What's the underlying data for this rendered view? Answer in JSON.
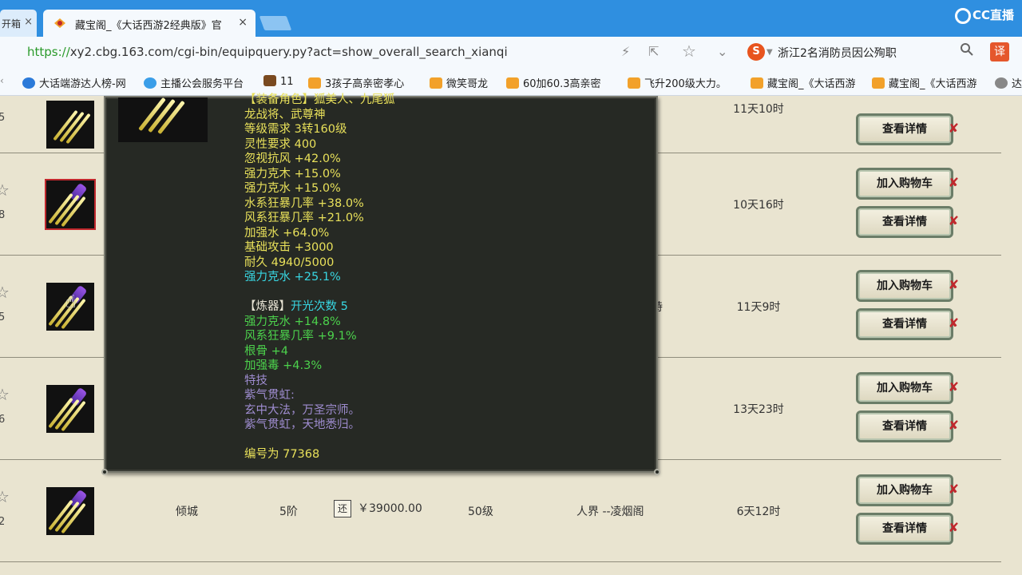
{
  "browser": {
    "small_tab_label": "开箱",
    "active_tab_title": "藏宝阁_《大话西游2经典版》官",
    "url_proto": "https://",
    "url_rest": "xy2.cbg.163.com/cgi-bin/equipquery.py?act=show_overall_search_xianqi",
    "search_text": "浙江2名消防员因公殉职",
    "search_engine_letter": "S",
    "translate_label": "译",
    "cc_logo": "CC直播"
  },
  "bookmarks": [
    {
      "label": "大话端游达人榜-网",
      "color": "#2b7ad9"
    },
    {
      "label": "主播公会服务平台",
      "color": "#3a9ee8"
    },
    {
      "label": "11",
      "color": "#7a4a20"
    },
    {
      "label": "3孩子高亲密孝心",
      "color": "#f2a12a"
    },
    {
      "label": "微笑哥龙",
      "color": "#f2a12a"
    },
    {
      "label": "60加60.3高亲密",
      "color": "#f2a12a"
    },
    {
      "label": "飞升200级大力。",
      "color": "#f2a12a"
    },
    {
      "label": "藏宝阁_《大话西游",
      "color": "#f2a12a"
    },
    {
      "label": "藏宝阁_《大话西游",
      "color": "#f2a12a"
    },
    {
      "label": "达",
      "color": "#888888"
    }
  ],
  "rows": [
    {
      "left_num": "5",
      "time": "11天10时",
      "buttons": [
        "查看详情"
      ]
    },
    {
      "left_num": "8",
      "time": "10天16时",
      "buttons": [
        "加入购物车",
        "查看详情"
      ]
    },
    {
      "left_num": "5",
      "time": "11天9时",
      "buttons": [
        "加入购物车",
        "查看详情"
      ],
      "partial": "特"
    },
    {
      "left_num": "6",
      "time": "13天23时",
      "buttons": [
        "加入购物车",
        "查看详情"
      ]
    },
    {
      "left_num": "2",
      "time": "6天12时",
      "buttons": [
        "加入购物车",
        "查看详情"
      ],
      "name": "倾城",
      "grade": "5阶",
      "price_tag": "还",
      "price": "￥39000.00",
      "level": "50级",
      "server": "人界 --凌烟阁"
    }
  ],
  "tooltip": {
    "lines": [
      {
        "text": "【装备角色】狐美人、九尾狐",
        "color": "yellow"
      },
      {
        "text": "龙战将、武尊神",
        "color": "yellow"
      },
      {
        "text": "等级需求 3转160级",
        "color": "yellow"
      },
      {
        "text": "灵性要求 400",
        "color": "yellow"
      },
      {
        "text": "忽视抗风 +42.0%",
        "color": "yellow"
      },
      {
        "text": "强力克木 +15.0%",
        "color": "yellow"
      },
      {
        "text": "强力克水 +15.0%",
        "color": "yellow"
      },
      {
        "text": "水系狂暴几率 +38.0%",
        "color": "yellow"
      },
      {
        "text": "风系狂暴几率 +21.0%",
        "color": "yellow"
      },
      {
        "text": "加强水 +64.0%",
        "color": "yellow"
      },
      {
        "text": "基础攻击 +3000",
        "color": "yellow"
      },
      {
        "text": "耐久 4940/5000",
        "color": "yellow"
      },
      {
        "text": "强力克水 +25.1%",
        "color": "cyan"
      },
      {
        "text": "",
        "color": "yellow"
      },
      {
        "text": "【炼器】",
        "color": "white",
        "suffix": "开光次数 5",
        "suffix_color": "cyan"
      },
      {
        "text": "强力克水 +14.8%",
        "color": "green"
      },
      {
        "text": "风系狂暴几率 +9.1%",
        "color": "green"
      },
      {
        "text": "根骨 +4",
        "color": "green"
      },
      {
        "text": "加强毒 +4.3%",
        "color": "green"
      },
      {
        "text": "特技",
        "color": "purple"
      },
      {
        "text": "紫气贯虹:",
        "color": "purple"
      },
      {
        "text": "玄中大法，万圣宗师。",
        "color": "purple"
      },
      {
        "text": "紫气贯虹，天地悉归。",
        "color": "purple"
      },
      {
        "text": "",
        "color": "yellow"
      },
      {
        "text": "编号为 77368",
        "color": "yellow"
      }
    ]
  },
  "colors": {
    "red_x": "#c0282d",
    "row_bg": "#e9e4d0",
    "tooltip_bg": "#262924"
  },
  "icons": {
    "close": "×",
    "star": "☆",
    "bolt": "⚡",
    "bookmark_star": "☆",
    "chevron": "⌄",
    "search": "⚲",
    "cursor": "☝"
  }
}
